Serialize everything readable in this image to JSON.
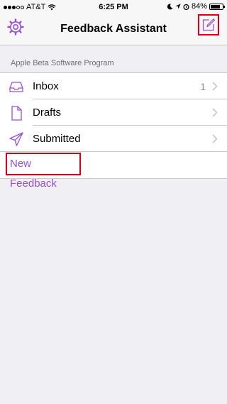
{
  "status_bar": {
    "carrier": "AT&T",
    "time": "6:25 PM",
    "battery": "84%",
    "battery_level": 0.84,
    "icons": [
      "signal-dots-icon",
      "wifi-icon",
      "moon-icon",
      "location-icon",
      "alarm-icon",
      "battery-icon"
    ]
  },
  "nav": {
    "title": "Feedback Assistant",
    "left_icon": "gear-icon",
    "right_icon": "compose-icon"
  },
  "section": {
    "header": "Apple Beta Software Program"
  },
  "items": [
    {
      "label": "Inbox",
      "count": "1",
      "icon": "inbox-tray-icon"
    },
    {
      "label": "Drafts",
      "count": "",
      "icon": "document-icon"
    },
    {
      "label": "Submitted",
      "count": "",
      "icon": "paper-plane-icon"
    }
  ],
  "new_feedback": {
    "label": "New Feedback"
  },
  "colors": {
    "accent": "#9b4fd6",
    "highlight": "#d9001b",
    "background": "#efeff4"
  }
}
